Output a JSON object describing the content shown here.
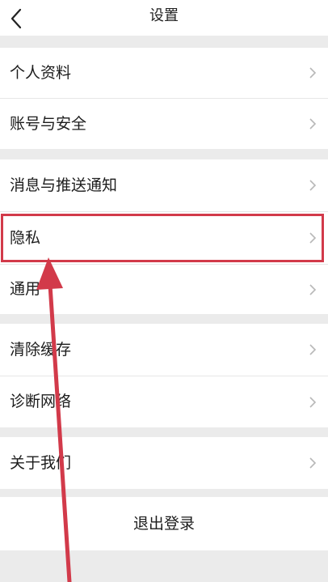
{
  "header": {
    "title": "设置",
    "back_icon": "chevron-left-icon"
  },
  "sections": [
    {
      "items": [
        {
          "label": "个人资料",
          "icon": "chevron-right-icon"
        },
        {
          "label": "账号与安全",
          "icon": "chevron-right-icon"
        }
      ]
    },
    {
      "items": [
        {
          "label": "消息与推送通知",
          "icon": "chevron-right-icon"
        },
        {
          "label": "隐私",
          "icon": "chevron-right-icon",
          "highlighted": true
        },
        {
          "label": "通用",
          "icon": "chevron-right-icon"
        }
      ]
    },
    {
      "items": [
        {
          "label": "清除缓存",
          "icon": "chevron-right-icon"
        },
        {
          "label": "诊断网络",
          "icon": "chevron-right-icon"
        }
      ]
    },
    {
      "items": [
        {
          "label": "关于我们",
          "icon": "chevron-right-icon"
        }
      ]
    }
  ],
  "logout": {
    "label": "退出登录"
  },
  "annotation": {
    "highlight_color": "#d23a4a",
    "arrow_color": "#d23a4a"
  }
}
